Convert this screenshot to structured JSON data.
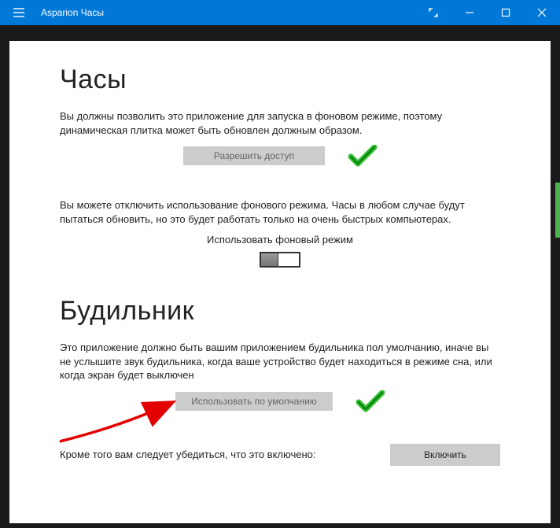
{
  "titlebar": {
    "app_title": "Asparion Часы"
  },
  "clock_section": {
    "heading": "Часы",
    "permission_desc": "Вы должны позволить это приложение для запуска в фоновом режиме, поэтому динамическая плитка может быть обновлен должным образом.",
    "allow_button": "Разрешить доступ",
    "bg_disable_desc": "Вы можете отключить использование фонового режима. Часы в любом случае будут пытаться обновить, но это будет работать только на очень быстрых компьютерах.",
    "bg_toggle_label": "Использовать фоновый режим"
  },
  "alarm_section": {
    "heading": "Будильник",
    "default_desc": "Это приложение должно быть вашим приложением будильника пол умолчанию, иначе вы не услышите звук будильника, когда ваше устройство будет находиться в режиме сна, или когда экран будет выключен",
    "default_button": "Использовать по умолчанию",
    "enable_desc": "Кроме того вам следует убедиться, что это включено:",
    "enable_button": "Включить"
  }
}
